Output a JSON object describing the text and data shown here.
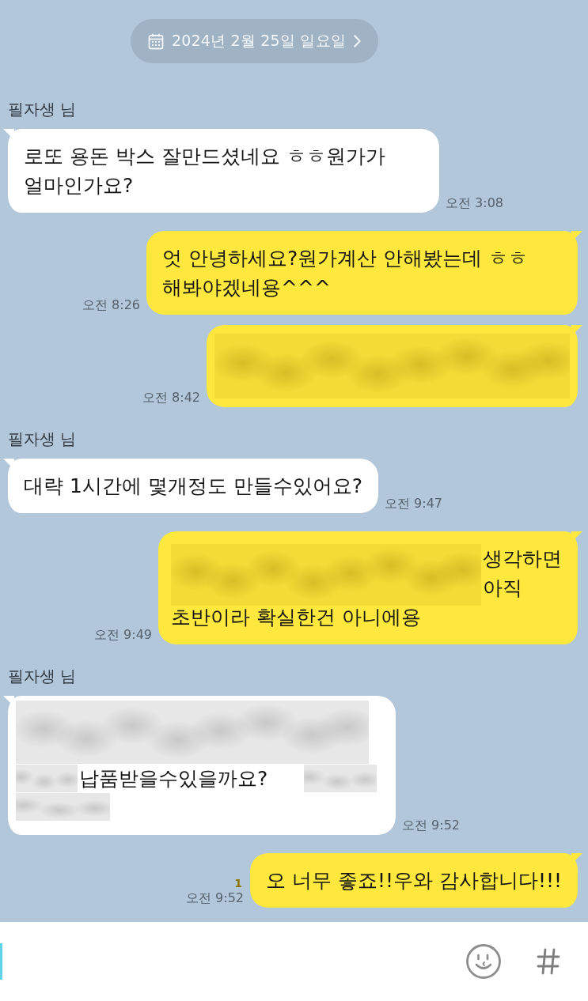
{
  "date_divider": {
    "label": "2024년 2월 25일 일요일"
  },
  "messages": [
    {
      "outgoing": false,
      "sender": "필자생 님",
      "kind": "text",
      "text": "로또 용돈 박스 잘만드셨네요 ㅎㅎ원가가 얼마인가요?",
      "time": "오전 3:08"
    },
    {
      "outgoing": true,
      "kind": "text",
      "text": "엇 안녕하세요?원가계산 안해봤는데 ㅎㅎ 해봐야겠네용^^^",
      "time": "오전 8:26"
    },
    {
      "outgoing": true,
      "kind": "blurred",
      "time": "오전 8:42"
    },
    {
      "outgoing": false,
      "sender": "필자생 님",
      "kind": "text",
      "text": "대략 1시간에 몇개정도 만들수있어요?",
      "time": "오전 9:47"
    },
    {
      "outgoing": true,
      "kind": "partly_blurred_top",
      "fragments": [
        "생각하면",
        "아직",
        "초반이라 확실한건 아니에용"
      ],
      "time": "오전 9:49"
    },
    {
      "outgoing": false,
      "sender": "필자생 님",
      "kind": "partly_blurred_middle",
      "fragments": [
        "납품받을수있을까요?"
      ],
      "time": "오전 9:52"
    },
    {
      "outgoing": true,
      "kind": "text",
      "text": "오 너무 좋죠!!우와 감사합니다!!!",
      "time": "오전 9:52",
      "unread": "1"
    }
  ]
}
